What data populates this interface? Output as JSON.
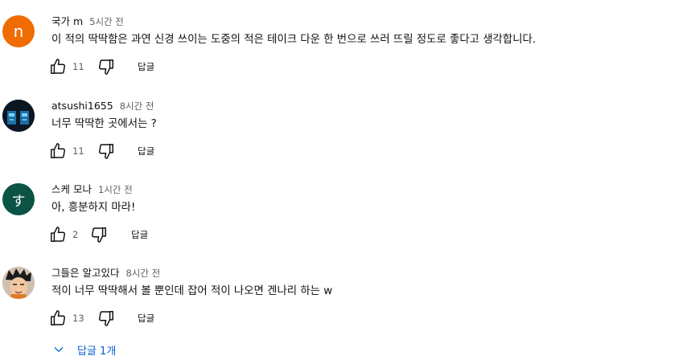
{
  "comments": [
    {
      "author": "국가 m",
      "time": "5시간 전",
      "text": "이 적의 딱딱함은 과연 신경 쓰이는 도중의 적은 테이크 다운 한 번으로 쓰러 뜨릴 정도로 좋다고 생각합니다.",
      "likes": "11",
      "reply_label": "답글",
      "avatar": {
        "letter": "n",
        "color": "#ef6c00"
      }
    },
    {
      "author": "atsushi1655",
      "time": "8시간 전",
      "text": "너무 딱딱한 곳에서는 ?",
      "likes": "11",
      "reply_label": "답글",
      "avatar": {
        "letter": "",
        "color": "#0b1622"
      }
    },
    {
      "author": "스케 모나",
      "time": "1시간 전",
      "text": "아, 흥분하지 마라!",
      "likes": "2",
      "reply_label": "답글",
      "avatar": {
        "letter": "す",
        "color": "#0b5345"
      }
    },
    {
      "author": "그들은 알고있다",
      "time": "8시간 전",
      "text": "적이 너무 딱딱해서 볼 뿐인데 잡어 적이 나오면 겐나리 하는 w",
      "likes": "13",
      "reply_label": "답글",
      "avatar": {
        "letter": "",
        "color": "#c9b8a8"
      }
    }
  ],
  "replies_toggle": {
    "label": "답글 1개",
    "color": "#065fd4"
  },
  "icons": {
    "like": "thumbs-up-icon",
    "dislike": "thumbs-down-icon",
    "expand": "chevron-down-icon"
  }
}
